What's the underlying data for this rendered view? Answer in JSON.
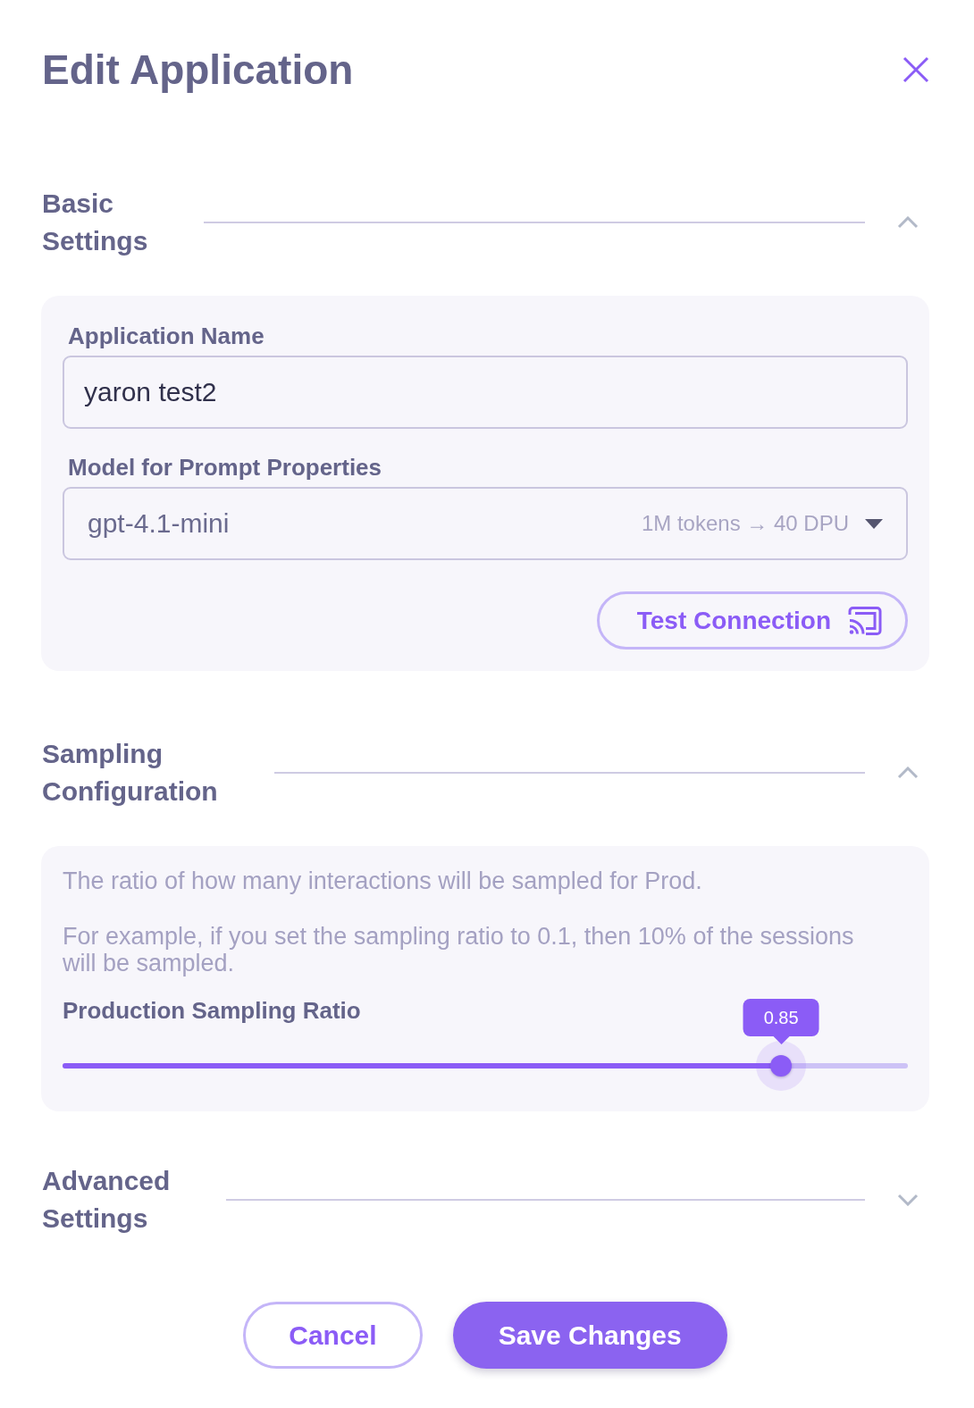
{
  "dialog": {
    "title": "Edit Application"
  },
  "sections": [
    {
      "title": "Basic Settings",
      "expanded": true,
      "kind": "form",
      "fields": [
        {
          "kind": "text",
          "label": "Application Name",
          "value": "yaron test2"
        },
        {
          "kind": "select",
          "label": "Model for Prompt Properties",
          "value": "gpt-4.1-mini",
          "hint": "1M tokens → 40 DPU"
        }
      ],
      "action": {
        "label": "Test Connection"
      }
    },
    {
      "title": "Sampling Configuration",
      "expanded": true,
      "kind": "slider",
      "description": [
        "The ratio of how many interactions will be sampled for Prod.",
        "For example, if you set the sampling ratio to 0.1, then 10% of the sessions will be sampled."
      ],
      "slider": {
        "label": "Production Sampling Ratio",
        "level": 0.85,
        "reading": "0.85"
      }
    },
    {
      "title": "Advanced Settings",
      "expanded": false
    }
  ],
  "buttons": [
    {
      "kind": "secondary",
      "label": "Cancel"
    },
    {
      "kind": "primary",
      "label": "Save Changes"
    }
  ]
}
